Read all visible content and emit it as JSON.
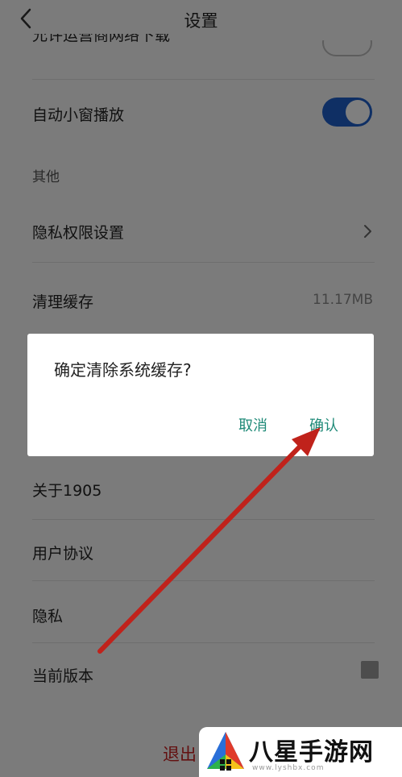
{
  "header": {
    "title": "设置",
    "back_icon": "chevron-left-icon"
  },
  "settings": {
    "partial_row_label": "允许运营商网络下载",
    "auto_pip_label": "自动小窗播放",
    "auto_pip_on": true,
    "section_other": "其他",
    "privacy_permissions_label": "隐私权限设置",
    "clear_cache_label": "清理缓存",
    "cache_size": "11.17MB",
    "about_label": "关于1905",
    "user_agreement_label": "用户协议",
    "privacy_label": "隐私",
    "current_version_label": "当前版本",
    "logout_label": "退出"
  },
  "dialog": {
    "message": "确定清除系统缓存?",
    "cancel_label": "取消",
    "confirm_label": "确认"
  },
  "watermark": {
    "brand": "八星手游网",
    "url": "www.lyshbx.com"
  },
  "colors": {
    "toggle_on": "#1e5ec8",
    "dialog_button": "#1f8a78",
    "logout": "#c62020",
    "annotation_arrow": "#c0221b"
  }
}
